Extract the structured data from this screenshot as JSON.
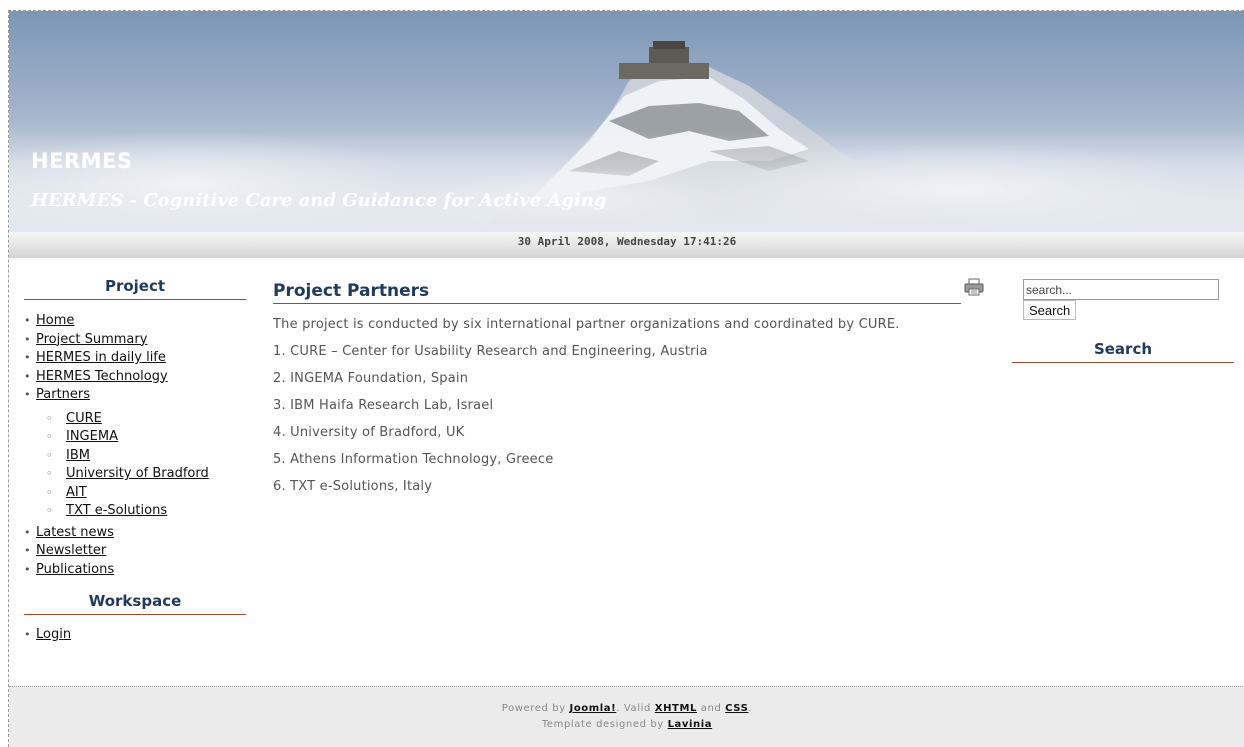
{
  "header": {
    "site_title": "HERMES",
    "slogan": "HERMES - Cognitive Care and Guidance for Active Aging"
  },
  "datebar": {
    "datetime": "30 April 2008, Wednesday 17:41:26"
  },
  "left": {
    "project_title": "Project",
    "menu": [
      {
        "label": "Home"
      },
      {
        "label": "Project Summary"
      },
      {
        "label": "HERMES in daily life"
      },
      {
        "label": "HERMES Technology"
      },
      {
        "label": "Partners"
      }
    ],
    "submenu": [
      {
        "label": "CURE"
      },
      {
        "label": "INGEMA"
      },
      {
        "label": "IBM"
      },
      {
        "label": "University of Bradford"
      },
      {
        "label": "AIT"
      },
      {
        "label": "TXT e-Solutions"
      }
    ],
    "menu2": [
      {
        "label": "Latest news"
      },
      {
        "label": "Newsletter"
      },
      {
        "label": "Publications"
      }
    ],
    "workspace_title": "Workspace",
    "workspace_menu": [
      {
        "label": "Login"
      }
    ]
  },
  "main": {
    "title": "Project Partners",
    "print_icon": "printer-icon",
    "intro": "The project is conducted by six international partner organizations and coordinated by CURE.",
    "partners": [
      "1. CURE – Center for Usability Research and Engineering, Austria",
      "2. INGEMA Foundation, Spain",
      "3. IBM Haifa Research Lab, Israel",
      "4. University of Bradford, UK",
      "5. Athens Information Technology, Greece",
      "6. TXT e-Solutions, Italy"
    ]
  },
  "right": {
    "search_value": "search...",
    "search_button": "Search",
    "search_title": "Search"
  },
  "footer": {
    "powered_by": "Powered by ",
    "joomla": "Joomla!",
    "valid": ". Valid ",
    "xhtml": "XHTML",
    "and": " and ",
    "css": "CSS",
    "period": ".",
    "designed": "Template designed by ",
    "lavinia": "Lavinia"
  },
  "colors": {
    "heading": "#1f3a5a",
    "rule": "#a04a2a",
    "footer_bg": "#ebebeb"
  }
}
